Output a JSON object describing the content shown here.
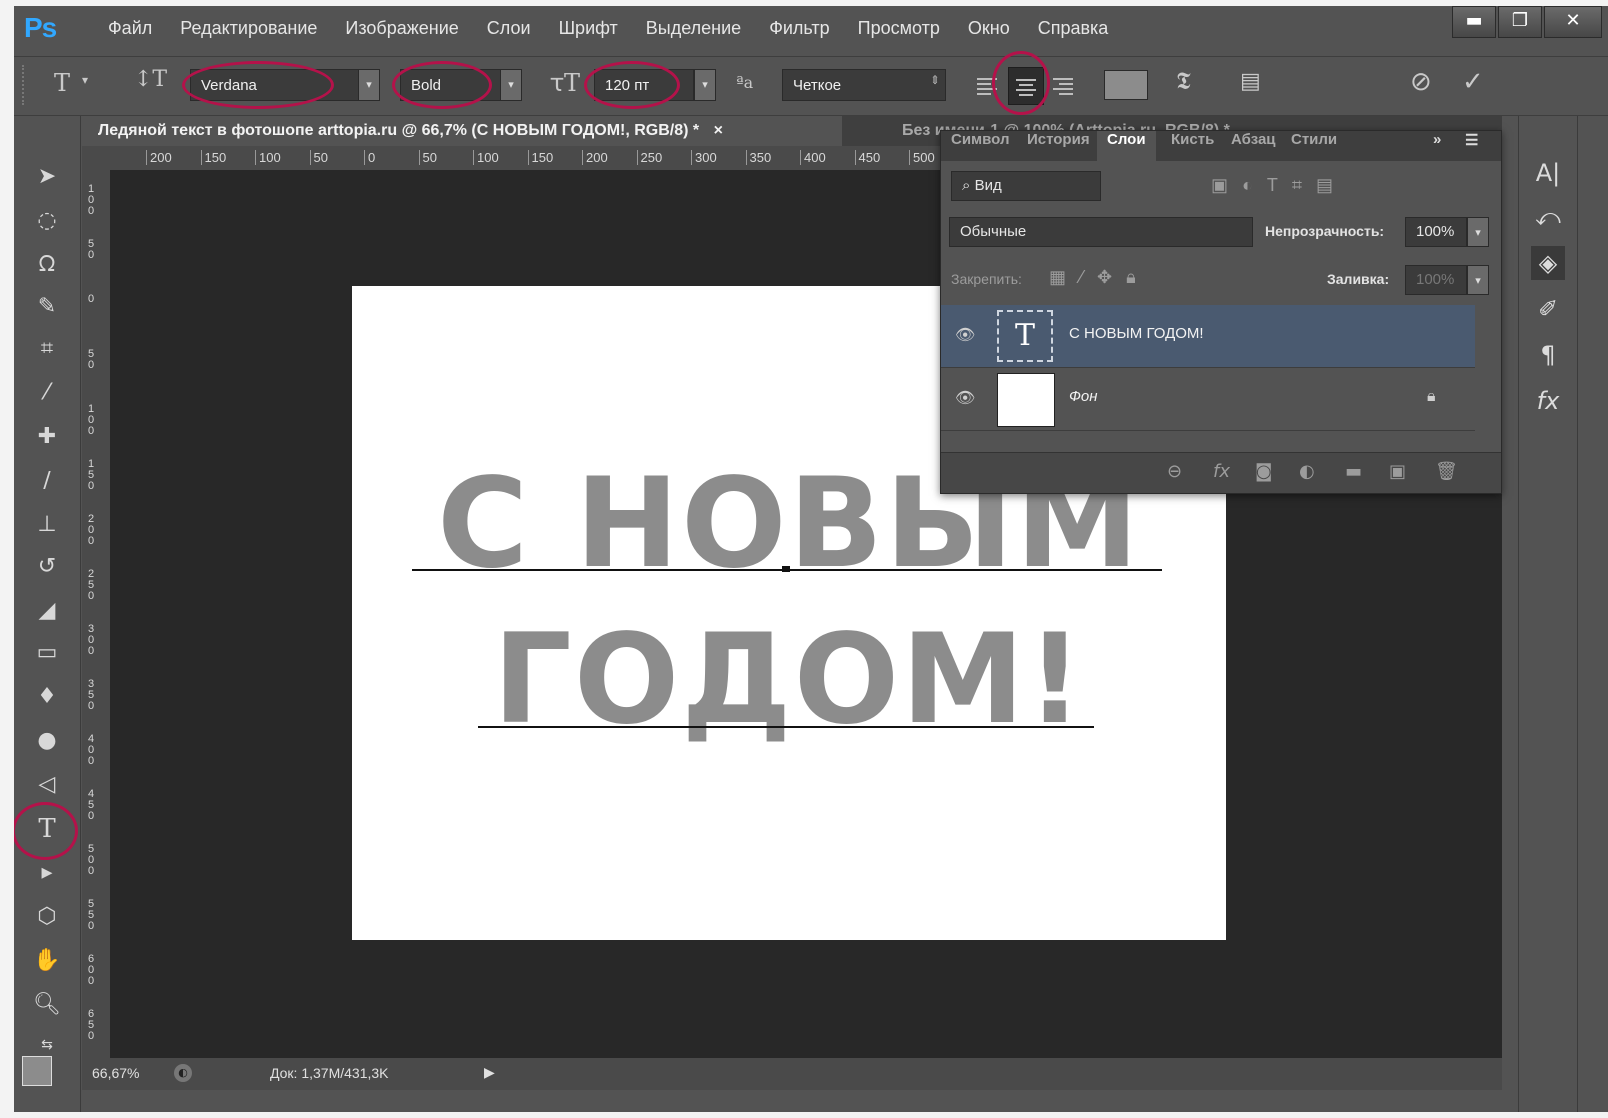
{
  "app": {
    "logo": "Ps"
  },
  "menu": [
    "Файл",
    "Редактирование",
    "Изображение",
    "Слои",
    "Шрифт",
    "Выделение",
    "Фильтр",
    "Просмотр",
    "Окно",
    "Справка"
  ],
  "window_controls": {
    "minimize": "▬",
    "maximize": "❐",
    "close": "✕"
  },
  "options": {
    "font_family": "Verdana",
    "font_style": "Bold",
    "font_size": "120 пт",
    "antialias": "Четкое",
    "aa_icon": "ªa",
    "text_color": "#8c8c8c"
  },
  "document": {
    "tab_title": "Ледяной текст в фотошопе arttopia.ru @ 66,7% (С НОВЫМ ГОДОМ!, RGB/8) *",
    "tab_close": "×",
    "second_tab": "Без имени-1 @ 100% (Arttopia.ru, RGB/8) *",
    "text_line1": "С НОВЫМ",
    "text_line2": "ГОДОМ!",
    "ruler_h": [
      "200",
      "150",
      "100",
      "50",
      "0",
      "50",
      "100",
      "150",
      "200",
      "250",
      "300",
      "350",
      "400",
      "450",
      "500"
    ],
    "ruler_v": [
      "1 0 0",
      "5 0",
      "0",
      "5 0",
      "1 0 0",
      "1 5 0",
      "2 0 0",
      "2 5 0",
      "3 0 0",
      "3 5 0",
      "4 0 0",
      "4 5 0",
      "5 0 0",
      "5 5 0",
      "6 0 0",
      "6 5 0"
    ]
  },
  "status": {
    "zoom": "66,67%",
    "doc": "Док: 1,37M/431,3K"
  },
  "layers_panel": {
    "tabs": [
      "Символ",
      "История",
      "Слои",
      "Кисть",
      "Абзац",
      "Стили"
    ],
    "active_tab": "Слои",
    "filter": "Вид",
    "blend_mode": "Обычные",
    "opacity_label": "Непрозрачность:",
    "opacity": "100%",
    "lock_label": "Закрепить:",
    "fill_label": "Заливка:",
    "fill": "100%",
    "layers": [
      {
        "name": "С НОВЫМ ГОДОМ!",
        "type": "text",
        "selected": true
      },
      {
        "name": "Фон",
        "type": "background",
        "locked": true
      }
    ]
  },
  "highlight_color": "#b4124a"
}
